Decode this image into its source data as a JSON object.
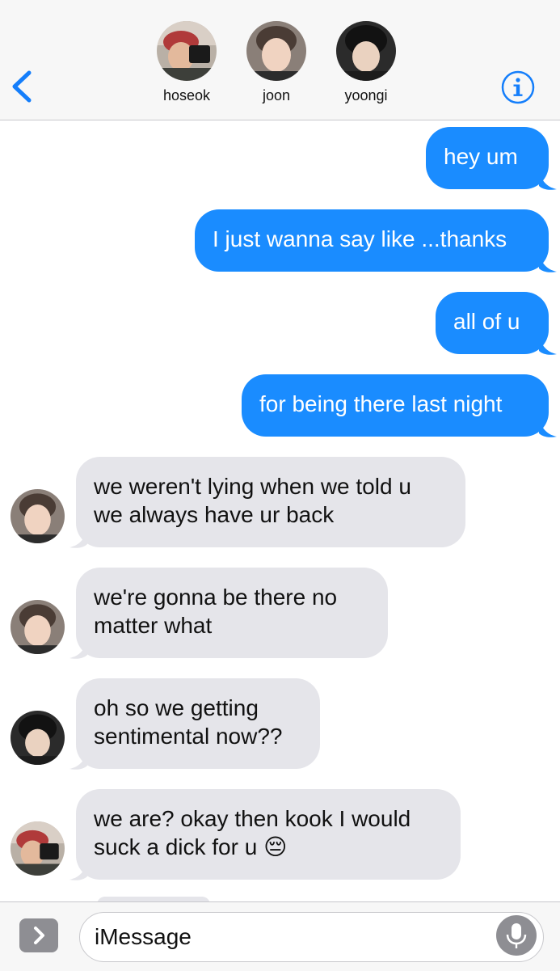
{
  "header": {
    "contacts": [
      {
        "name": "hoseok"
      },
      {
        "name": "joon"
      },
      {
        "name": "yoongi"
      }
    ],
    "back_icon": "chevron-left-icon",
    "info_icon": "info-icon",
    "accent_color": "#147efb"
  },
  "messages": [
    {
      "direction": "out",
      "text": "hey um"
    },
    {
      "direction": "out",
      "text": "I just wanna say like ...thanks"
    },
    {
      "direction": "out",
      "text": "all of u"
    },
    {
      "direction": "out",
      "text": "for being there last night"
    },
    {
      "direction": "in",
      "sender": "joon",
      "text": "we weren't lying when we told u\nwe always have ur back"
    },
    {
      "direction": "in",
      "sender": "joon",
      "text": "we're gonna be there no\nmatter what"
    },
    {
      "direction": "in",
      "sender": "yoongi",
      "text": "oh so we getting\nsentimental now??"
    },
    {
      "direction": "in",
      "sender": "hoseok",
      "text": "we are? okay then kook I would\nsuck a dick for u 😔"
    }
  ],
  "compose": {
    "placeholder": "iMessage",
    "apps_icon": "chevron-right-icon",
    "mic_icon": "microphone-icon"
  },
  "colors": {
    "outgoing_bubble": "#1a8cff",
    "incoming_bubble": "#e5e5ea"
  }
}
